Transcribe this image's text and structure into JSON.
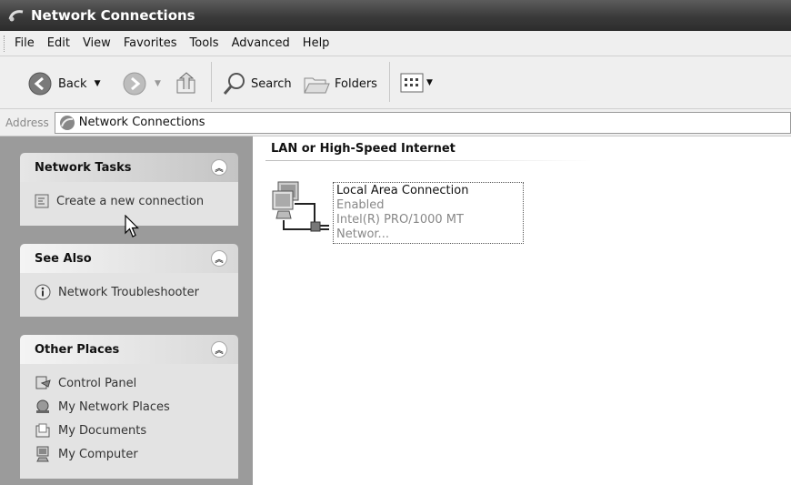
{
  "window": {
    "title": "Network Connections",
    "icon": "network-connections-icon"
  },
  "menu": [
    "File",
    "Edit",
    "View",
    "Favorites",
    "Tools",
    "Advanced",
    "Help"
  ],
  "toolbar": {
    "back_label": "Back",
    "search_label": "Search",
    "folders_label": "Folders"
  },
  "address": {
    "label": "Address",
    "value": "Network Connections"
  },
  "tasks": {
    "network_tasks": {
      "title": "Network Tasks",
      "items": [
        "Create a new connection"
      ]
    },
    "see_also": {
      "title": "See Also",
      "items": [
        "Network Troubleshooter"
      ]
    },
    "other_places": {
      "title": "Other Places",
      "items": [
        "Control Panel",
        "My Network Places",
        "My Documents",
        "My Computer"
      ]
    }
  },
  "content": {
    "group_title": "LAN or High-Speed Internet",
    "connection": {
      "name": "Local Area Connection",
      "status": "Enabled",
      "device": "Intel(R) PRO/1000 MT Networ..."
    }
  }
}
